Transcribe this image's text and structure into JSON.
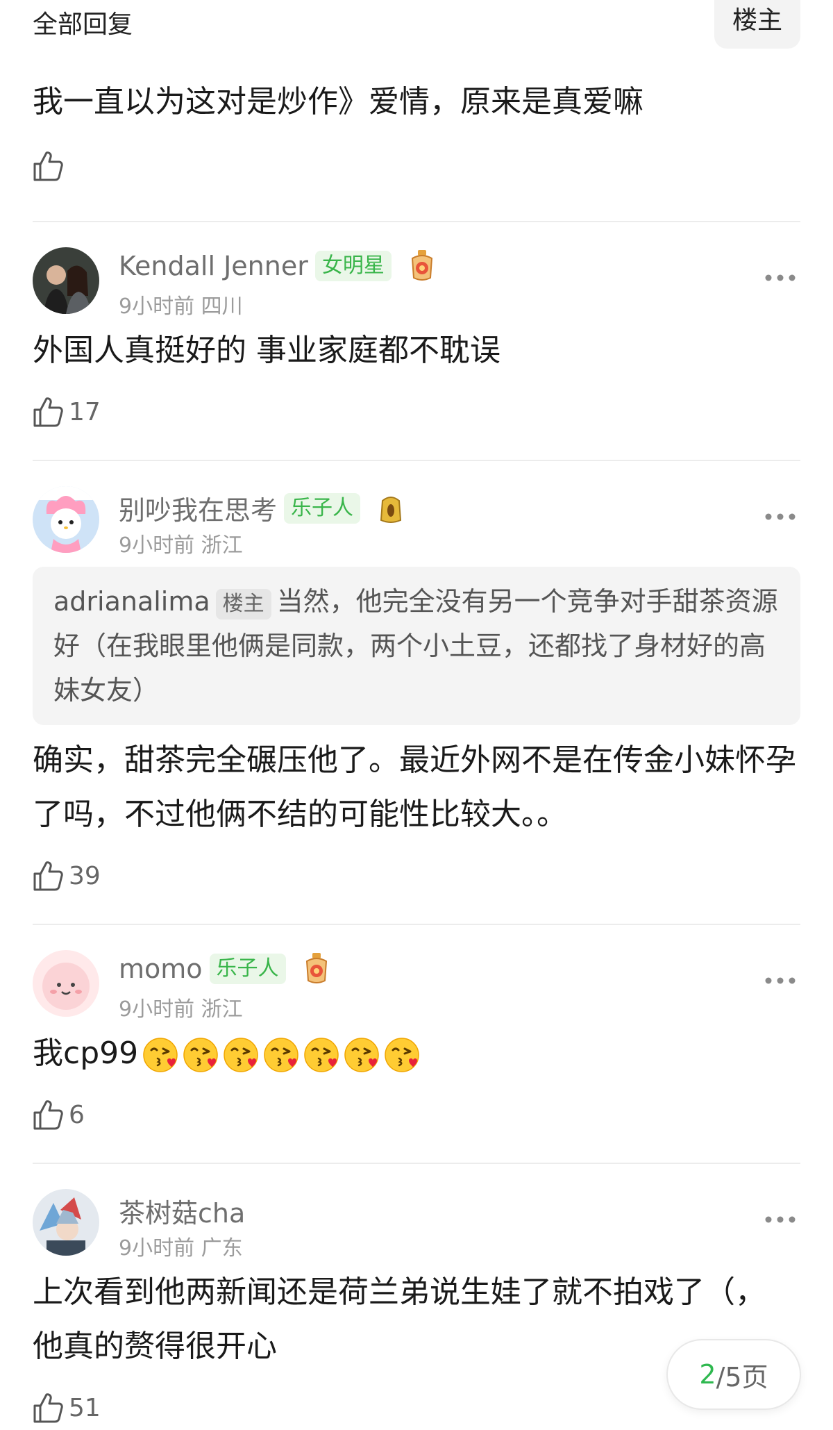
{
  "header": {
    "section_title": "全部回复",
    "op_filter": "楼主"
  },
  "first_reply": {
    "text": "我一直以为这对是炒作》爱情，原来是真爱嘛",
    "likes": ""
  },
  "comments": [
    {
      "username": "Kendall Jenner",
      "tag": "女明星",
      "time": "9小时前",
      "location": "四川",
      "text": "外国人真挺好的 事业家庭都不耽误",
      "likes": "17"
    },
    {
      "username": "别吵我在思考",
      "tag": "乐子人",
      "time": "9小时前",
      "location": "浙江",
      "quote": {
        "user": "adrianalima",
        "tag": "楼主",
        "text": "当然，他完全没有另一个竞争对手甜茶资源好（在我眼里他俩是同款，两个小土豆，还都找了身材好的高妹女友）"
      },
      "text": "确实，甜茶完全碾压他了。最近外网不是在传金小妹怀孕了吗，不过他俩不结的可能性比较大。。",
      "likes": "39"
    },
    {
      "username": "momo",
      "tag": "乐子人",
      "time": "9小时前",
      "location": "浙江",
      "text": "我cp99",
      "emoji_count": 7,
      "likes": "6"
    },
    {
      "username": "茶树菇cha",
      "time": "9小时前",
      "location": "广东",
      "text": "上次看到他两新闻还是荷兰弟说生娃了就不拍戏了（，他真的赘得很开心",
      "likes": "51"
    }
  ],
  "pager": {
    "current": "2",
    "total": "/5页"
  },
  "colors": {
    "tag_green": "#39b54a",
    "pager_current": "#2eb84f"
  }
}
